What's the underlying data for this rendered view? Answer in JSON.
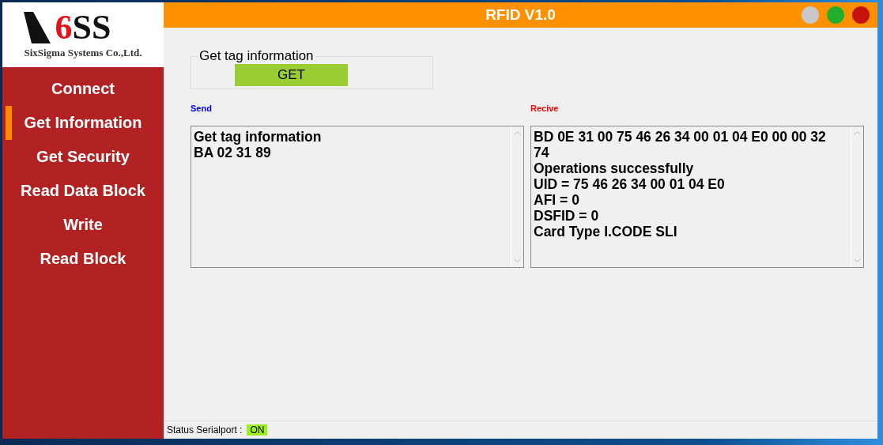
{
  "logo": {
    "accent": "6",
    "rest": "SS",
    "subtitle": "SixSigma Systems Co.,Ltd."
  },
  "window": {
    "title": "RFID V1.0",
    "controls": [
      {
        "color": "#c8c8c8"
      },
      {
        "color": "#22b02c"
      },
      {
        "color": "#c8120e"
      }
    ]
  },
  "sidebar": {
    "items": [
      {
        "label": "Connect",
        "selected": false
      },
      {
        "label": "Get Information",
        "selected": true
      },
      {
        "label": "Get Security",
        "selected": false
      },
      {
        "label": "Read Data Block",
        "selected": false
      },
      {
        "label": "Write",
        "selected": false
      },
      {
        "label": "Read Block",
        "selected": false
      }
    ]
  },
  "group": {
    "title": "Get tag information",
    "button": "GET"
  },
  "send": {
    "label": "Send",
    "lines": [
      "Get tag information",
      "BA 02 31 89"
    ]
  },
  "receive": {
    "label": "Recive",
    "lines": [
      "BD 0E 31 00 75 46 26 34 00 01 04 E0 00 00 32 74",
      "Operations successfully",
      "UID = 75 46 26 34 00 01 04 E0",
      "AFI = 0",
      "DSFID = 0",
      "Card Type I.CODE SLI"
    ]
  },
  "status_bar": {
    "label": "Status Serialport :",
    "value": "ON"
  }
}
